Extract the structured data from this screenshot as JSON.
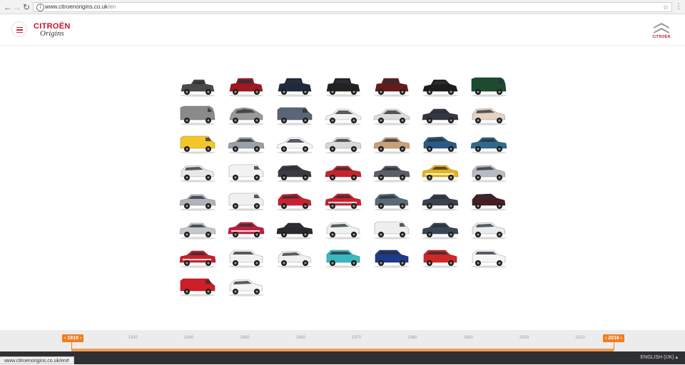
{
  "browser": {
    "url_host": "www.citroenorigins.co.uk",
    "url_path": "/en",
    "status_url": "www.citroenorigins.co.uk/en#"
  },
  "header": {
    "brand": "CITROËN",
    "brand_sub": "Origins",
    "right_logo_text": "CITROËN"
  },
  "colors": {
    "brand_red": "#c8102e",
    "timeline_orange": "#f07d1e"
  },
  "cars": [
    {
      "shape": "vintage_open",
      "color": "#4a4a4a"
    },
    {
      "shape": "vintage",
      "color": "#a01820"
    },
    {
      "shape": "vintage",
      "color": "#1f2a40"
    },
    {
      "shape": "vintage",
      "color": "#222222"
    },
    {
      "shape": "vintage",
      "color": "#6a1a1c"
    },
    {
      "shape": "traction",
      "color": "#1c1c1c"
    },
    {
      "shape": "van_tall",
      "color": "#1e4a30"
    },
    {
      "shape": "van_tall",
      "color": "#8a8a88"
    },
    {
      "shape": "2cv",
      "color": "#9a9a9a"
    },
    {
      "shape": "van",
      "color": "#5a6677"
    },
    {
      "shape": "ds",
      "color": "#f0f0f0"
    },
    {
      "shape": "ds",
      "color": "#dcdcdc"
    },
    {
      "shape": "sedan",
      "color": "#333840"
    },
    {
      "shape": "hatch",
      "color": "#e5d3c3"
    },
    {
      "shape": "van",
      "color": "#f2c72a"
    },
    {
      "shape": "sedan",
      "color": "#9aa0a8"
    },
    {
      "shape": "ds",
      "color": "#f4f4f4"
    },
    {
      "shape": "sedan",
      "color": "#d8d8d8"
    },
    {
      "shape": "sedan",
      "color": "#c9a07a"
    },
    {
      "shape": "hatch",
      "color": "#2a5a86"
    },
    {
      "shape": "sedan",
      "color": "#2f6a8c"
    },
    {
      "shape": "hatch",
      "color": "#e8e8e8"
    },
    {
      "shape": "van",
      "color": "#f2f2f2"
    },
    {
      "shape": "hatch",
      "color": "#3a3a40"
    },
    {
      "shape": "sedan",
      "color": "#c8232a"
    },
    {
      "shape": "sedan",
      "color": "#5a5e66"
    },
    {
      "shape": "rally",
      "color": "#e6b21e"
    },
    {
      "shape": "hatch",
      "color": "#b8bcc2"
    },
    {
      "shape": "sedan",
      "color": "#b0b4ba"
    },
    {
      "shape": "van",
      "color": "#f0f0f0"
    },
    {
      "shape": "hatch",
      "color": "#cc2030"
    },
    {
      "shape": "rally",
      "color": "#cc2030"
    },
    {
      "shape": "hatch",
      "color": "#5a6a76"
    },
    {
      "shape": "sedan",
      "color": "#3a4250"
    },
    {
      "shape": "hatch",
      "color": "#4a1c22"
    },
    {
      "shape": "sedan",
      "color": "#c4c8cc"
    },
    {
      "shape": "rally",
      "color": "#c0203a"
    },
    {
      "shape": "sedan",
      "color": "#2a2a2e"
    },
    {
      "shape": "hatch",
      "color": "#eef2ee"
    },
    {
      "shape": "van",
      "color": "#eeeeee"
    },
    {
      "shape": "sedan",
      "color": "#3a4658"
    },
    {
      "shape": "hatch",
      "color": "#e8ecee"
    },
    {
      "shape": "rally",
      "color": "#c8202a"
    },
    {
      "shape": "suv",
      "color": "#f2f2f2"
    },
    {
      "shape": "hatch",
      "color": "#f0f0f0"
    },
    {
      "shape": "suv",
      "color": "#3ab8c0"
    },
    {
      "shape": "suv",
      "color": "#1e3a8a"
    },
    {
      "shape": "suv",
      "color": "#d02828"
    },
    {
      "shape": "suv",
      "color": "#f6f6f6"
    },
    {
      "shape": "van",
      "color": "#cc1f27"
    },
    {
      "shape": "hatch",
      "color": "#f4f4f4"
    }
  ],
  "timeline": {
    "start_badge": "1919",
    "end_badge": "2016",
    "years": [
      "1930",
      "1940",
      "1950",
      "1960",
      "1970",
      "1980",
      "1990",
      "2000",
      "2010"
    ],
    "start_value": 1919,
    "end_value": 2016
  },
  "footer": {
    "language": "ENGLISH (UK)"
  }
}
